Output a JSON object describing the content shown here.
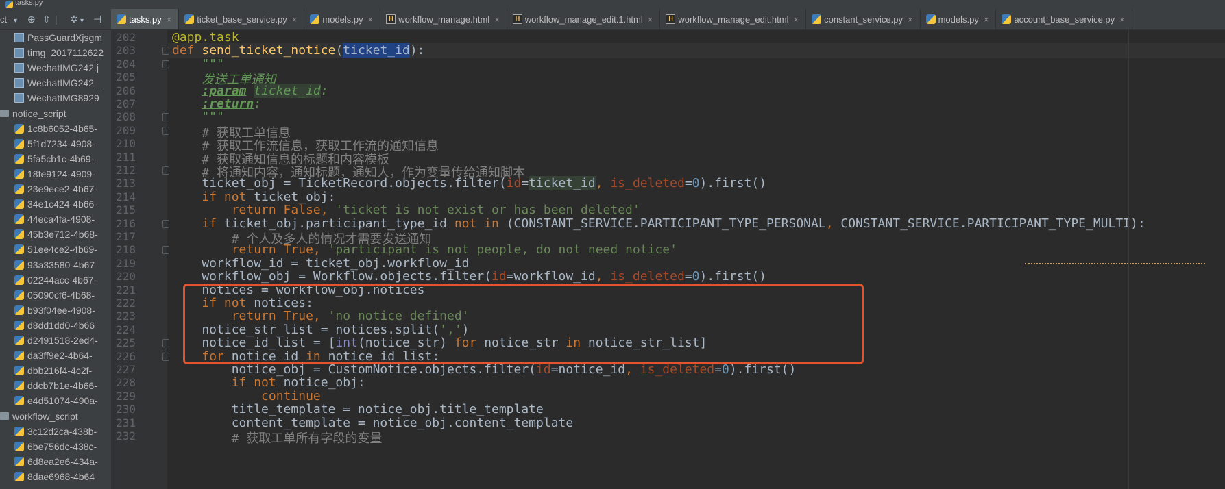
{
  "window": {
    "title": "tasks.py"
  },
  "toolbar": {
    "project_label": "ct",
    "dropdown_icon": "chevron-down-icon",
    "icons": [
      "target-icon",
      "collapse-icon",
      "gear-icon",
      "pin-icon"
    ]
  },
  "tabs": [
    {
      "label": "tasks.py",
      "type": "py",
      "active": true
    },
    {
      "label": "ticket_base_service.py",
      "type": "py",
      "active": false
    },
    {
      "label": "models.py",
      "type": "py",
      "active": false
    },
    {
      "label": "workflow_manage.html",
      "type": "html",
      "active": false
    },
    {
      "label": "workflow_manage_edit.1.html",
      "type": "html",
      "active": false
    },
    {
      "label": "workflow_manage_edit.html",
      "type": "html",
      "active": false
    },
    {
      "label": "constant_service.py",
      "type": "py",
      "active": false
    },
    {
      "label": "models.py",
      "type": "py",
      "active": false
    },
    {
      "label": "account_base_service.py",
      "type": "py",
      "active": false
    }
  ],
  "sidebar": {
    "items": [
      {
        "label": "PassGuardXjsgm",
        "type": "img",
        "indent": 1
      },
      {
        "label": "timg_2017112622",
        "type": "img",
        "indent": 1
      },
      {
        "label": "WechatIMG242.j",
        "type": "img",
        "indent": 1
      },
      {
        "label": "WechatIMG242_",
        "type": "img",
        "indent": 1
      },
      {
        "label": "WechatIMG8929",
        "type": "img",
        "indent": 1
      },
      {
        "label": "notice_script",
        "type": "folder",
        "indent": 0
      },
      {
        "label": "1c8b6052-4b65-",
        "type": "py",
        "indent": 1
      },
      {
        "label": "5f1d7234-4908-",
        "type": "py",
        "indent": 1
      },
      {
        "label": "5fa5cb1c-4b69-",
        "type": "py",
        "indent": 1
      },
      {
        "label": "18fe9124-4909-",
        "type": "py",
        "indent": 1
      },
      {
        "label": "23e9ece2-4b67-",
        "type": "py",
        "indent": 1
      },
      {
        "label": "34e1c424-4b66-",
        "type": "py",
        "indent": 1
      },
      {
        "label": "44eca4fa-4908-",
        "type": "py",
        "indent": 1
      },
      {
        "label": "45b3e712-4b68-",
        "type": "py",
        "indent": 1
      },
      {
        "label": "51ee4ce2-4b69-",
        "type": "py",
        "indent": 1
      },
      {
        "label": "93a33580-4b67",
        "type": "py",
        "indent": 1
      },
      {
        "label": "02244acc-4b67-",
        "type": "py",
        "indent": 1
      },
      {
        "label": "05090cf6-4b68-",
        "type": "py",
        "indent": 1
      },
      {
        "label": "b93f04ee-4908-",
        "type": "py",
        "indent": 1
      },
      {
        "label": "d8dd1dd0-4b66",
        "type": "py",
        "indent": 1
      },
      {
        "label": "d2491518-2ed4-",
        "type": "py",
        "indent": 1
      },
      {
        "label": "da3ff9e2-4b64-",
        "type": "py",
        "indent": 1
      },
      {
        "label": "dbb216f4-4c2f-",
        "type": "py",
        "indent": 1
      },
      {
        "label": "ddcb7b1e-4b66-",
        "type": "py",
        "indent": 1
      },
      {
        "label": "e4d51074-490a-",
        "type": "py",
        "indent": 1
      },
      {
        "label": "workflow_script",
        "type": "folder",
        "indent": 0
      },
      {
        "label": "3c12d2ca-438b-",
        "type": "py",
        "indent": 1
      },
      {
        "label": "6be756dc-438c-",
        "type": "py",
        "indent": 1
      },
      {
        "label": "6d8ea2e6-434a-",
        "type": "py",
        "indent": 1
      },
      {
        "label": "8dae6968-4b64",
        "type": "py",
        "indent": 1
      }
    ]
  },
  "colors": {
    "keyword": "#cc7832",
    "function": "#ffc66d",
    "string": "#6a8759",
    "number": "#6897bb",
    "comment": "#808080",
    "docstring": "#629755",
    "param": "#aa4926",
    "decorator": "#bbb529",
    "builtin": "#8888c6",
    "default": "#a9b7c6",
    "highlight_box": "#e4532d"
  },
  "editor": {
    "current_line": 203,
    "lines": [
      {
        "num": "202",
        "tokens": [
          [
            "deco",
            "@app.task"
          ]
        ]
      },
      {
        "num": "203",
        "tokens": [
          [
            "kw",
            "def "
          ],
          [
            "fn",
            "send_ticket_notice"
          ],
          [
            "d",
            "("
          ],
          [
            "sel",
            "ticket_id"
          ],
          [
            "d",
            "):"
          ]
        ]
      },
      {
        "num": "204",
        "tokens": [
          [
            "doc",
            "    \"\"\""
          ]
        ]
      },
      {
        "num": "205",
        "tokens": [
          [
            "doc",
            "    发送工单通知"
          ]
        ]
      },
      {
        "num": "206",
        "tokens": [
          [
            "doc",
            "    "
          ],
          [
            "doctag",
            ":param"
          ],
          [
            "doc",
            " "
          ],
          [
            "docparam",
            "ticket_id"
          ],
          [
            "doc",
            ":"
          ]
        ]
      },
      {
        "num": "207",
        "tokens": [
          [
            "doc",
            "    "
          ],
          [
            "doctag",
            ":return"
          ],
          [
            "doc",
            ":"
          ]
        ]
      },
      {
        "num": "208",
        "tokens": [
          [
            "doc",
            "    \"\"\""
          ]
        ]
      },
      {
        "num": "209",
        "tokens": [
          [
            "cm",
            "    # 获取工单信息"
          ]
        ]
      },
      {
        "num": "210",
        "tokens": [
          [
            "cm",
            "    # 获取工作流信息，获取工作流的通知信息"
          ]
        ]
      },
      {
        "num": "211",
        "tokens": [
          [
            "cm",
            "    # 获取通知信息的标题和内容模板"
          ]
        ]
      },
      {
        "num": "212",
        "tokens": [
          [
            "cm",
            "    # 将通知内容，通知标题，通知人，作为变量传给通知脚本"
          ]
        ]
      },
      {
        "num": "213",
        "tokens": [
          [
            "d",
            "    ticket_obj = TicketRecord.objects.filter("
          ],
          [
            "pm",
            "id"
          ],
          [
            "d",
            "="
          ],
          [
            "var",
            "ticket_id"
          ],
          [
            "kw",
            ", "
          ],
          [
            "pm",
            "is_deleted"
          ],
          [
            "d",
            "="
          ],
          [
            "num",
            "0"
          ],
          [
            "d",
            ").first()"
          ]
        ]
      },
      {
        "num": "214",
        "tokens": [
          [
            "d",
            "    "
          ],
          [
            "kw",
            "if not "
          ],
          [
            "d",
            "ticket_obj:"
          ]
        ]
      },
      {
        "num": "215",
        "tokens": [
          [
            "d",
            "        "
          ],
          [
            "kw",
            "return False, "
          ],
          [
            "str",
            "'ticket is not exist or has been deleted'"
          ]
        ]
      },
      {
        "num": "216",
        "tokens": [
          [
            "d",
            "    "
          ],
          [
            "kw",
            "if "
          ],
          [
            "d",
            "ticket_obj.participant_type_id "
          ],
          [
            "kw",
            "not in "
          ],
          [
            "d",
            "(CONSTANT_SERVICE.PARTICIPANT_TYPE_PERSONAL"
          ],
          [
            "kw",
            ", "
          ],
          [
            "d",
            "CONSTANT_SERVICE.PARTICIPANT_TYPE_MULTI):"
          ]
        ]
      },
      {
        "num": "217",
        "tokens": [
          [
            "cm",
            "        # 个人及多人的情况才需要发送通知"
          ]
        ]
      },
      {
        "num": "218",
        "tokens": [
          [
            "d",
            "        "
          ],
          [
            "kw",
            "return True, "
          ],
          [
            "str",
            "'participant is not people, do not need notice'"
          ]
        ]
      },
      {
        "num": "219",
        "tokens": [
          [
            "d",
            "    workflow_id = ticket_obj.workflow_id"
          ]
        ]
      },
      {
        "num": "220",
        "tokens": [
          [
            "d",
            "    workflow_obj = Workflow.objects.filter("
          ],
          [
            "pm",
            "id"
          ],
          [
            "d",
            "=workflow_id"
          ],
          [
            "kw",
            ", "
          ],
          [
            "pm",
            "is_deleted"
          ],
          [
            "d",
            "="
          ],
          [
            "num",
            "0"
          ],
          [
            "d",
            ").first()"
          ]
        ]
      },
      {
        "num": "221",
        "tokens": [
          [
            "d",
            "    notices = workflow_obj.notices"
          ]
        ]
      },
      {
        "num": "222",
        "tokens": [
          [
            "d",
            "    "
          ],
          [
            "kw",
            "if not "
          ],
          [
            "d",
            "notices:"
          ]
        ]
      },
      {
        "num": "223",
        "tokens": [
          [
            "d",
            "        "
          ],
          [
            "kw",
            "return True, "
          ],
          [
            "str",
            "'no notice defined'"
          ]
        ]
      },
      {
        "num": "224",
        "tokens": [
          [
            "d",
            "    notice_str_list = notices.split("
          ],
          [
            "str",
            "','"
          ],
          [
            "d",
            ")"
          ]
        ]
      },
      {
        "num": "225",
        "tokens": [
          [
            "d",
            "    notice_id_list = ["
          ],
          [
            "bi",
            "int"
          ],
          [
            "d",
            "(notice_str) "
          ],
          [
            "kw",
            "for "
          ],
          [
            "d",
            "notice_str "
          ],
          [
            "kw",
            "in "
          ],
          [
            "d",
            "notice_str_list]"
          ]
        ]
      },
      {
        "num": "226",
        "tokens": [
          [
            "d",
            "    "
          ],
          [
            "kw",
            "for "
          ],
          [
            "d",
            "notice_id "
          ],
          [
            "kw",
            "in "
          ],
          [
            "d",
            "notice_id_list:"
          ]
        ]
      },
      {
        "num": "227",
        "tokens": [
          [
            "d",
            "        notice_obj = CustomNotice.objects.filter("
          ],
          [
            "pm",
            "id"
          ],
          [
            "d",
            "=notice_id"
          ],
          [
            "kw",
            ", "
          ],
          [
            "pm",
            "is_deleted"
          ],
          [
            "d",
            "="
          ],
          [
            "num",
            "0"
          ],
          [
            "d",
            ").first()"
          ]
        ]
      },
      {
        "num": "228",
        "tokens": [
          [
            "d",
            "        "
          ],
          [
            "kw",
            "if not "
          ],
          [
            "d",
            "notice_obj:"
          ]
        ]
      },
      {
        "num": "229",
        "tokens": [
          [
            "d",
            "            "
          ],
          [
            "kw",
            "continue"
          ]
        ]
      },
      {
        "num": "230",
        "tokens": [
          [
            "d",
            "        title_template = notice_obj.title_template"
          ]
        ]
      },
      {
        "num": "231",
        "tokens": [
          [
            "d",
            "        content_template = notice_obj.content_template"
          ]
        ]
      },
      {
        "num": "232",
        "tokens": [
          [
            "cm",
            "        # 获取工单所有字段的变量"
          ]
        ]
      }
    ]
  }
}
